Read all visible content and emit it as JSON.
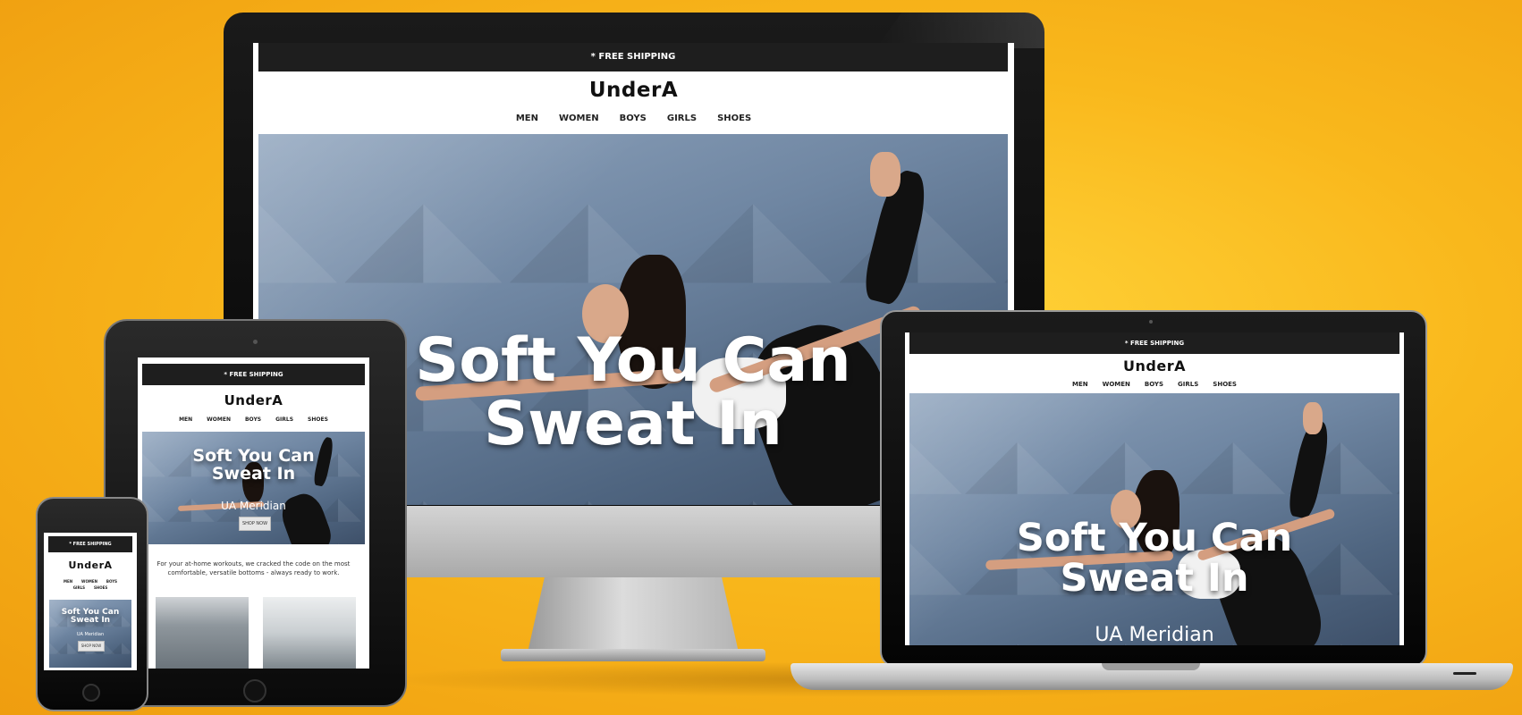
{
  "site": {
    "promo_bar": "* FREE SHIPPING",
    "brand": "UnderA",
    "nav": [
      "MEN",
      "WOMEN",
      "BOYS",
      "GIRLS",
      "SHOES"
    ],
    "hero_title_line1": "Soft You Can",
    "hero_title_line2": "Sweat In",
    "hero_subtitle": "UA Meridian",
    "cta": "SHOP NOW",
    "intro_text": "For your at-home workouts, we cracked the code on the most comfortable, versatile bottoms - always ready to work."
  }
}
